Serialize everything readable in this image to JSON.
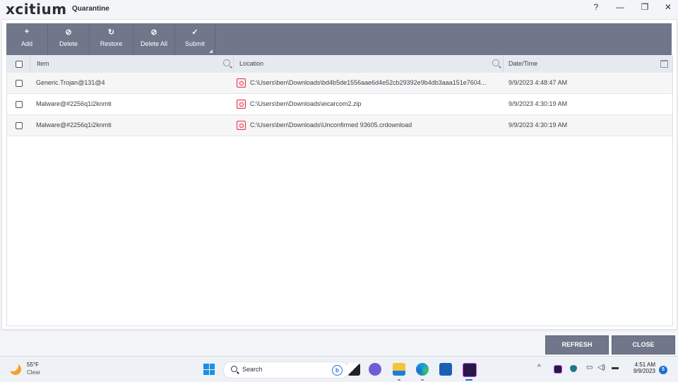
{
  "window": {
    "brand": "xcitium",
    "title": "Quarantine",
    "controls": {
      "help": "?",
      "minimize": "—",
      "restore": "❐",
      "close": "✕"
    }
  },
  "toolbar": {
    "buttons": [
      {
        "label": "Add",
        "icon": "plus-icon",
        "glyph": "+"
      },
      {
        "label": "Delete",
        "icon": "block-icon",
        "glyph": "⊘"
      },
      {
        "label": "Restore",
        "icon": "restore-icon",
        "glyph": "↻"
      },
      {
        "label": "Delete All",
        "icon": "block-icon",
        "glyph": "⊘"
      },
      {
        "label": "Submit",
        "icon": "check-icon",
        "glyph": "✓"
      }
    ]
  },
  "table": {
    "columns": {
      "item": "Item",
      "location": "Location",
      "datetime": "Date/Time"
    },
    "rows": [
      {
        "item": "Generic.Trojan@131@4",
        "location": "C:\\Users\\ben\\Downloads\\bd4b5de1556aae6d4e52cb29392e9b4db3aaa151e7604...",
        "datetime": "9/9/2023 4:48:47 AM"
      },
      {
        "item": "Malware@#2256q1i2knmti",
        "location": "C:\\Users\\ben\\Downloads\\eicarcom2.zip",
        "datetime": "9/9/2023 4:30:19 AM"
      },
      {
        "item": "Malware@#2256q1i2knmti",
        "location": "C:\\Users\\ben\\Downloads\\Unconfirmed 93605.crdownload",
        "datetime": "9/9/2023 4:30:19 AM"
      }
    ]
  },
  "footer": {
    "refresh": "REFRESH",
    "close": "CLOSE"
  },
  "taskbar": {
    "weather": {
      "temp": "55°F",
      "desc": "Clear"
    },
    "search_placeholder": "Search",
    "bing": "b",
    "clock": {
      "time": "4:51 AM",
      "date": "9/9/2023"
    },
    "notifications": "5",
    "tray_chevron": "^"
  },
  "colors": {
    "toolbar": "#70778a",
    "accent": "#1a6fd6",
    "danger": "#e3344f"
  }
}
